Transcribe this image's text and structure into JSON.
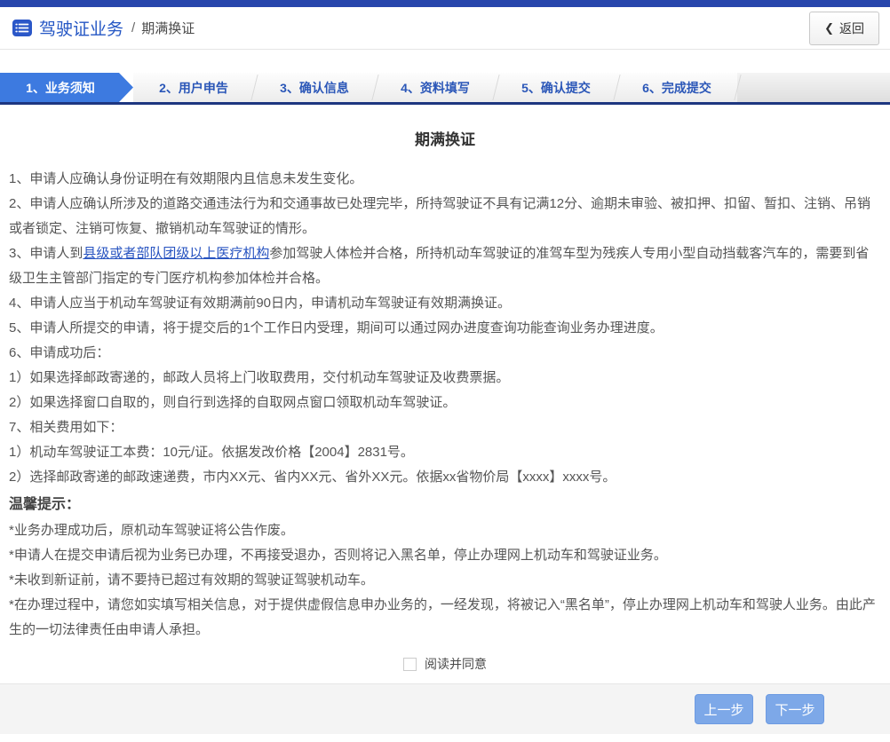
{
  "colors": {
    "top_bar": "#2746ac",
    "active_step": "#3d7ae0",
    "step_text": "#2b57b8",
    "header_title": "#2456c4",
    "link": "#2753c0",
    "button": "#7da8e8",
    "wizard_underline": "#1d3680"
  },
  "header": {
    "section_title": "驾驶证业务",
    "separator": "/",
    "page_name": "期满换证",
    "back_icon": "❮",
    "back_label": "返回"
  },
  "steps": {
    "items": [
      {
        "label": "1、业务须知",
        "active": true
      },
      {
        "label": "2、用户申告",
        "active": false
      },
      {
        "label": "3、确认信息",
        "active": false
      },
      {
        "label": "4、资料填写",
        "active": false
      },
      {
        "label": "5、确认提交",
        "active": false
      },
      {
        "label": "6、完成提交",
        "active": false
      }
    ]
  },
  "content": {
    "title": "期满换证",
    "notices": [
      "1、申请人应确认身份证明在有效期限内且信息未发生变化。",
      "2、申请人应确认所涉及的道路交通违法行为和交通事故已处理完毕，所持驾驶证不具有记满12分、逾期未审验、被扣押、扣留、暂扣、注销、吊销或者锁定、注销可恢复、撤销机动车驾驶证的情形。",
      "",
      "4、申请人应当于机动车驾驶证有效期满前90日内，申请机动车驾驶证有效期满换证。",
      "5、申请人所提交的申请，将于提交后的1个工作日内受理，期间可以通过网办进度查询功能查询业务办理进度。",
      "6、申请成功后：",
      "1）如果选择邮政寄递的，邮政人员将上门收取费用，交付机动车驾驶证及收费票据。",
      "2）如果选择窗口自取的，则自行到选择的自取网点窗口领取机动车驾驶证。",
      "7、相关费用如下：",
      "1）机动车驾驶证工本费：10元/证。依据发改价格【2004】2831号。",
      "2）选择邮政寄递的邮政速递费，市内XX元、省内XX元、省外XX元。依据xx省物价局【xxxx】xxxx号。"
    ],
    "notice3": {
      "pre": "3、申请人到",
      "link": "县级或者部队团级以上医疗机构",
      "post": "参加驾驶人体检并合格，所持机动车驾驶证的准驾车型为残疾人专用小型自动挡载客汽车的，需要到省级卫生主管部门指定的专门医疗机构参加体检并合格。"
    },
    "tips_title": "温馨提示：",
    "tips": [
      "*业务办理成功后，原机动车驾驶证将公告作废。",
      "*申请人在提交申请后视为业务已办理，不再接受退办，否则将记入黑名单，停止办理网上机动车和驾驶证业务。",
      "*未收到新证前，请不要持已超过有效期的驾驶证驾驶机动车。",
      "*在办理过程中，请您如实填写相关信息，对于提供虚假信息申办业务的，一经发现，将被记入“黑名单”，停止办理网上机动车和驾驶人业务。由此产生的一切法律责任由申请人承担。"
    ],
    "agree_label": "阅读并同意"
  },
  "footer": {
    "prev_label": "上一步",
    "next_label": "下一步"
  }
}
